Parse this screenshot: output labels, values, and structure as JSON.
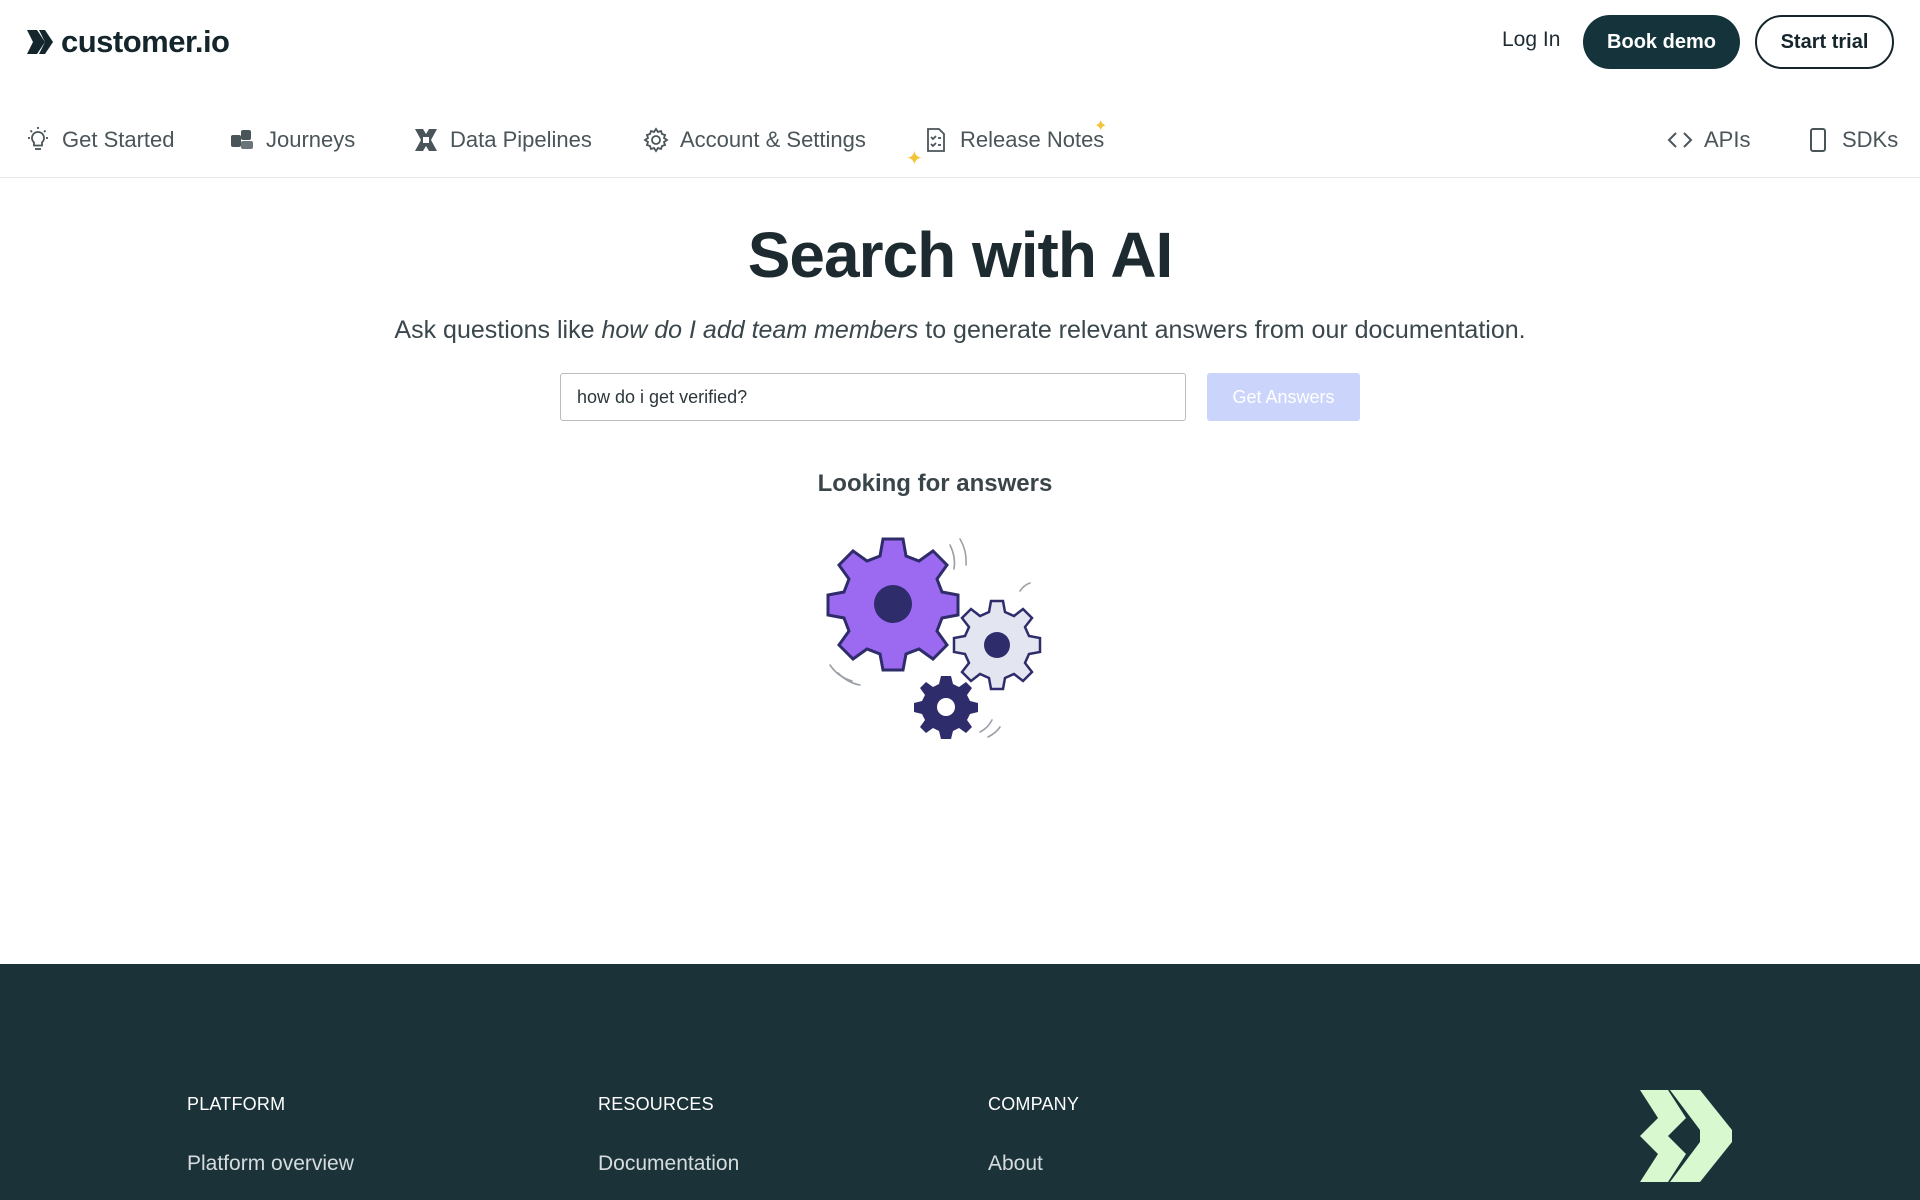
{
  "header": {
    "logo_text": "customer.io",
    "login_label": "Log In",
    "demo_label": "Book demo",
    "trial_label": "Start trial"
  },
  "nav": {
    "items": [
      {
        "label": "Get Started",
        "icon": "lightbulb-icon"
      },
      {
        "label": "Journeys",
        "icon": "journeys-icon"
      },
      {
        "label": "Data Pipelines",
        "icon": "pipelines-icon"
      },
      {
        "label": "Account & Settings",
        "icon": "gear-icon"
      },
      {
        "label": "Release Notes",
        "icon": "checklist-icon"
      }
    ],
    "right_items": [
      {
        "label": "APIs",
        "icon": "code-icon"
      },
      {
        "label": "SDKs",
        "icon": "phone-icon"
      }
    ]
  },
  "main": {
    "title": "Search with AI",
    "subtitle_prefix": "Ask questions like ",
    "subtitle_example": "how do I add team members",
    "subtitle_suffix": " to generate relevant answers from our documentation.",
    "search_value": "how do i get verified?",
    "button_label": "Get Answers",
    "status": "Looking for answers"
  },
  "footer": {
    "columns": [
      {
        "heading": "PLATFORM",
        "link": "Platform overview"
      },
      {
        "heading": "RESOURCES",
        "link": "Documentation"
      },
      {
        "heading": "COMPANY",
        "link": "About"
      }
    ]
  },
  "colors": {
    "brand_dark": "#14333b",
    "footer_bg": "#1b3239",
    "button_disabled": "#cbd5fb",
    "gear_purple": "#9c6af0",
    "gear_navy": "#2e2c6b",
    "accent_green": "#d8f8cf"
  }
}
